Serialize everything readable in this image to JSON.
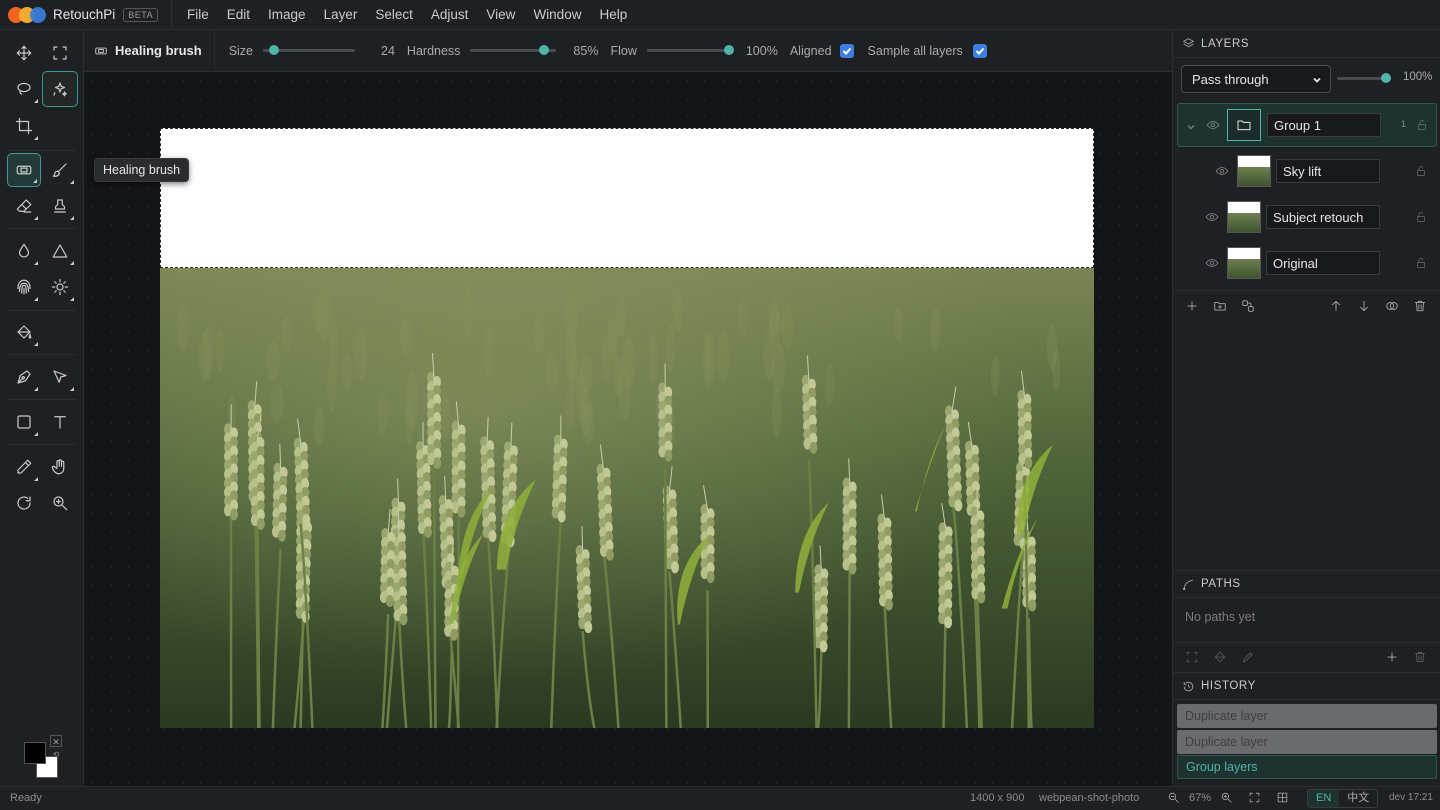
{
  "app": {
    "name": "RetouchPi",
    "badge": "BETA"
  },
  "menu": [
    "File",
    "Edit",
    "Image",
    "Layer",
    "Select",
    "Adjust",
    "View",
    "Window",
    "Help"
  ],
  "options": {
    "tool_name": "Healing brush",
    "size_label": "Size",
    "size_value": "24",
    "size_level": 0.12,
    "hardness_label": "Hardness",
    "hardness_value": "85%",
    "hardness_level": 0.85,
    "flow_label": "Flow",
    "flow_value": "100%",
    "flow_level": 1.0,
    "aligned_label": "Aligned",
    "aligned_checked": true,
    "sample_label": "Sample all layers",
    "sample_checked": true
  },
  "tooltip": "Healing brush",
  "layers_panel": {
    "title": "LAYERS",
    "blend_mode": "Pass through",
    "opacity": "100%",
    "layers": [
      {
        "name": "Group 1",
        "type": "group",
        "count": "1",
        "selected": true
      },
      {
        "name": "Sky lift",
        "type": "image",
        "selected": false
      },
      {
        "name": "Subject retouch",
        "type": "image",
        "selected": false
      },
      {
        "name": "Original",
        "type": "image",
        "selected": false
      }
    ]
  },
  "paths_panel": {
    "title": "PATHS",
    "empty_text": "No paths yet"
  },
  "history_panel": {
    "title": "HISTORY",
    "items": [
      {
        "label": "Duplicate layer",
        "state": "undone"
      },
      {
        "label": "Duplicate layer",
        "state": "undone"
      },
      {
        "label": "Group layers",
        "state": "current"
      }
    ]
  },
  "status": {
    "text": "Ready",
    "dimensions": "1400 x 900",
    "filename": "webpean-shot-photo",
    "zoom": "67%",
    "lang_active": "EN",
    "lang_other": "中文",
    "version": "dev 17:21"
  },
  "colors": {
    "accent": "#4db6a6",
    "checkbox": "#3d7fe0",
    "foreground": "#000000",
    "background": "#ffffff"
  }
}
